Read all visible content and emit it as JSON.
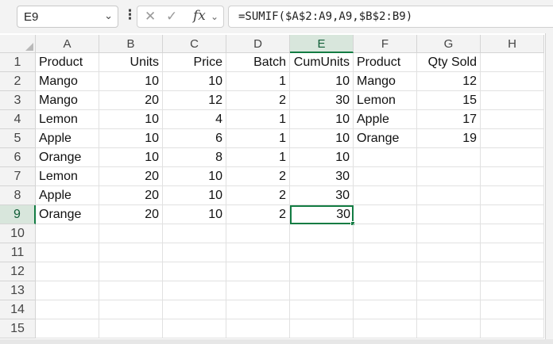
{
  "name_box": {
    "value": "E9"
  },
  "formula_bar": {
    "formula": "=SUMIF($A$2:A9,A9,$B$2:B9)",
    "fx_label": "fx"
  },
  "icons": {
    "cancel": "x-icon",
    "enter": "check-icon",
    "insert_function": "fx-icon",
    "more": "vertical-dots-icon",
    "dropdown": "chevron-down-icon"
  },
  "colors": {
    "selection_accent": "#137c43",
    "header_bg": "#f3f3f3"
  },
  "columns": [
    "A",
    "B",
    "C",
    "D",
    "E",
    "F",
    "G",
    "H"
  ],
  "rows": [
    "1",
    "2",
    "3",
    "4",
    "5",
    "6",
    "7",
    "8",
    "9",
    "10",
    "11",
    "12",
    "13",
    "14",
    "15"
  ],
  "selected": {
    "column": "E",
    "row": "9"
  },
  "cells": [
    [
      "Product",
      "Units",
      "Price",
      "Batch",
      "CumUnits",
      "Product",
      "Qty Sold",
      ""
    ],
    [
      "Mango",
      "10",
      "10",
      "1",
      "10",
      "Mango",
      "12",
      ""
    ],
    [
      "Mango",
      "20",
      "12",
      "2",
      "30",
      "Lemon",
      "15",
      ""
    ],
    [
      "Lemon",
      "10",
      "4",
      "1",
      "10",
      "Apple",
      "17",
      ""
    ],
    [
      "Apple",
      "10",
      "6",
      "1",
      "10",
      "Orange",
      "19",
      ""
    ],
    [
      "Orange",
      "10",
      "8",
      "1",
      "10",
      "",
      "",
      ""
    ],
    [
      "Lemon",
      "20",
      "10",
      "2",
      "30",
      "",
      "",
      ""
    ],
    [
      "Apple",
      "20",
      "10",
      "2",
      "30",
      "",
      "",
      ""
    ],
    [
      "Orange",
      "20",
      "10",
      "2",
      "30",
      "",
      "",
      ""
    ]
  ]
}
